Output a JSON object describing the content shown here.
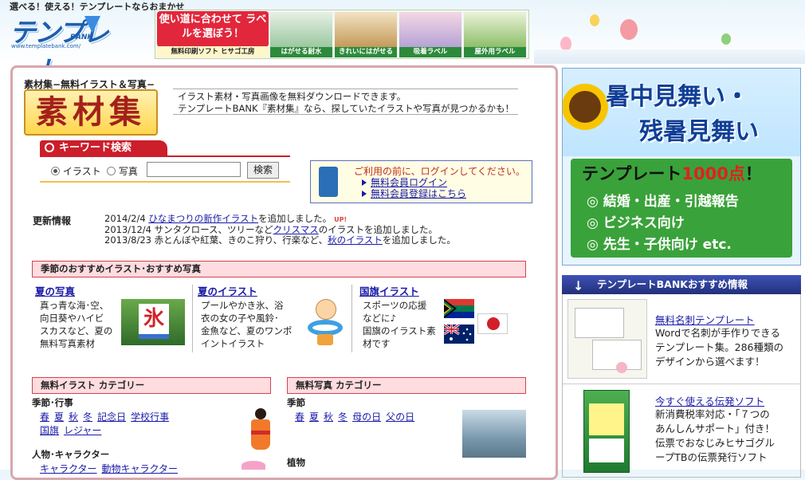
{
  "header": {
    "tagline": "選べる！使える！テンプレートならおまかせ",
    "logo_text": "テンプレート",
    "logo_sub": "BANK",
    "logo_url": "www.templatebank.com/",
    "banner": {
      "lead": "使い道に合わせて ラベルを選ぼう！",
      "free_soft": "無料印刷ソフト ヒサゴ工房",
      "tiles": [
        "はがせる耐水",
        "きれいにはがせる",
        "吸着ラベル",
        "屋外用ラベル"
      ]
    }
  },
  "sozai": {
    "subtitle": "素材集−無料イラスト＆写真−",
    "title": "素材集",
    "intro_line1": "イラスト素材・写真画像を無料ダウンロードできます。",
    "intro_line2": "テンプレートBANK『素材集』なら、探していたイラストや写真が見つかるかも！"
  },
  "search": {
    "tab_label": "キーワード検索",
    "radio_illust": "イラスト",
    "radio_photo": "写真",
    "input_value": "",
    "button_label": "検索"
  },
  "login": {
    "message": "ご利用の前に、ログインしてください。",
    "link_login": "無料会員ログイン",
    "link_register": "無料会員登録はこちら"
  },
  "news": {
    "heading": "更新情報",
    "items": [
      {
        "date": "2014/2/4",
        "link": "ひなまつりの新作イラスト",
        "rest": "を追加しました。",
        "badge": "UP!"
      },
      {
        "date": "2013/12/4",
        "pre": "サンタクロース、ツリーなど",
        "link": "クリスマス",
        "rest": "のイラストを追加しました。"
      },
      {
        "date": "2013/8/23",
        "pre": "赤とんぼや紅葉、きのこ狩り、行楽など、",
        "link": "秋のイラスト",
        "rest": "を追加しました。"
      }
    ]
  },
  "seasonal": {
    "heading": "季節のおすすめイラスト･おすすめ写真",
    "cols": [
      {
        "title": "夏の写真",
        "desc": [
          "真っ青な海･空、",
          "向日葵やハイビ",
          "スカスなど、夏の",
          "無料写真素材"
        ],
        "thumb_text": "氷"
      },
      {
        "title": "夏のイラスト",
        "desc": [
          "プールやかき氷、浴",
          "衣の女の子や風鈴･",
          "金魚など、夏のワンポ",
          "イントイラスト"
        ]
      },
      {
        "title": "国旗イラスト",
        "desc": [
          "スポーツの応援",
          "などに♪",
          "国旗のイラスト素",
          "材です"
        ]
      }
    ]
  },
  "illust_cat": {
    "heading": "無料イラスト カテゴリー",
    "season_label": "季節･行事",
    "season_links": [
      "春",
      "夏",
      "秋",
      "冬",
      "記念日",
      "学校行事",
      "国旗",
      "レジャー"
    ],
    "people_label": "人物･キャラクター",
    "people_links": [
      "キャラクター",
      "動物キャラクター"
    ]
  },
  "photo_cat": {
    "heading": "無料写真 カテゴリー",
    "season_label": "季節",
    "season_links": [
      "春",
      "夏",
      "秋",
      "冬",
      "母の日",
      "父の日"
    ],
    "plant_label": "植物"
  },
  "ad": {
    "line1": "暑中見舞い・",
    "line2": "残暑見舞い",
    "count_prefix": "テンプレート",
    "count_num": "1000点",
    "count_suffix": "！",
    "items": [
      "◎ 結婚・出産・引越報告",
      "◎ ビジネス向け",
      "◎ 先生・子供向け etc."
    ]
  },
  "recommend": {
    "heading": "テンプレートBANKおすすめ情報",
    "items": [
      {
        "title": "無料名刺テンプレート",
        "desc": [
          "Wordで名刺が手作りできる",
          "テンプレート集。286種類の",
          "デザインから選べます！"
        ]
      },
      {
        "title": "今すぐ使える伝発ソフト",
        "desc": [
          "新消費税率対応・「７つの",
          "あんしんサポート」付き！",
          "伝票でおなじみヒサゴグル",
          "ープTBの伝票発行ソフト"
        ]
      }
    ]
  },
  "colors": {
    "accent_red": "#cc1e2b",
    "pink_section": "#ffdcdf",
    "link_blue": "#1a1aa8",
    "ad_green": "#3aa23a"
  }
}
